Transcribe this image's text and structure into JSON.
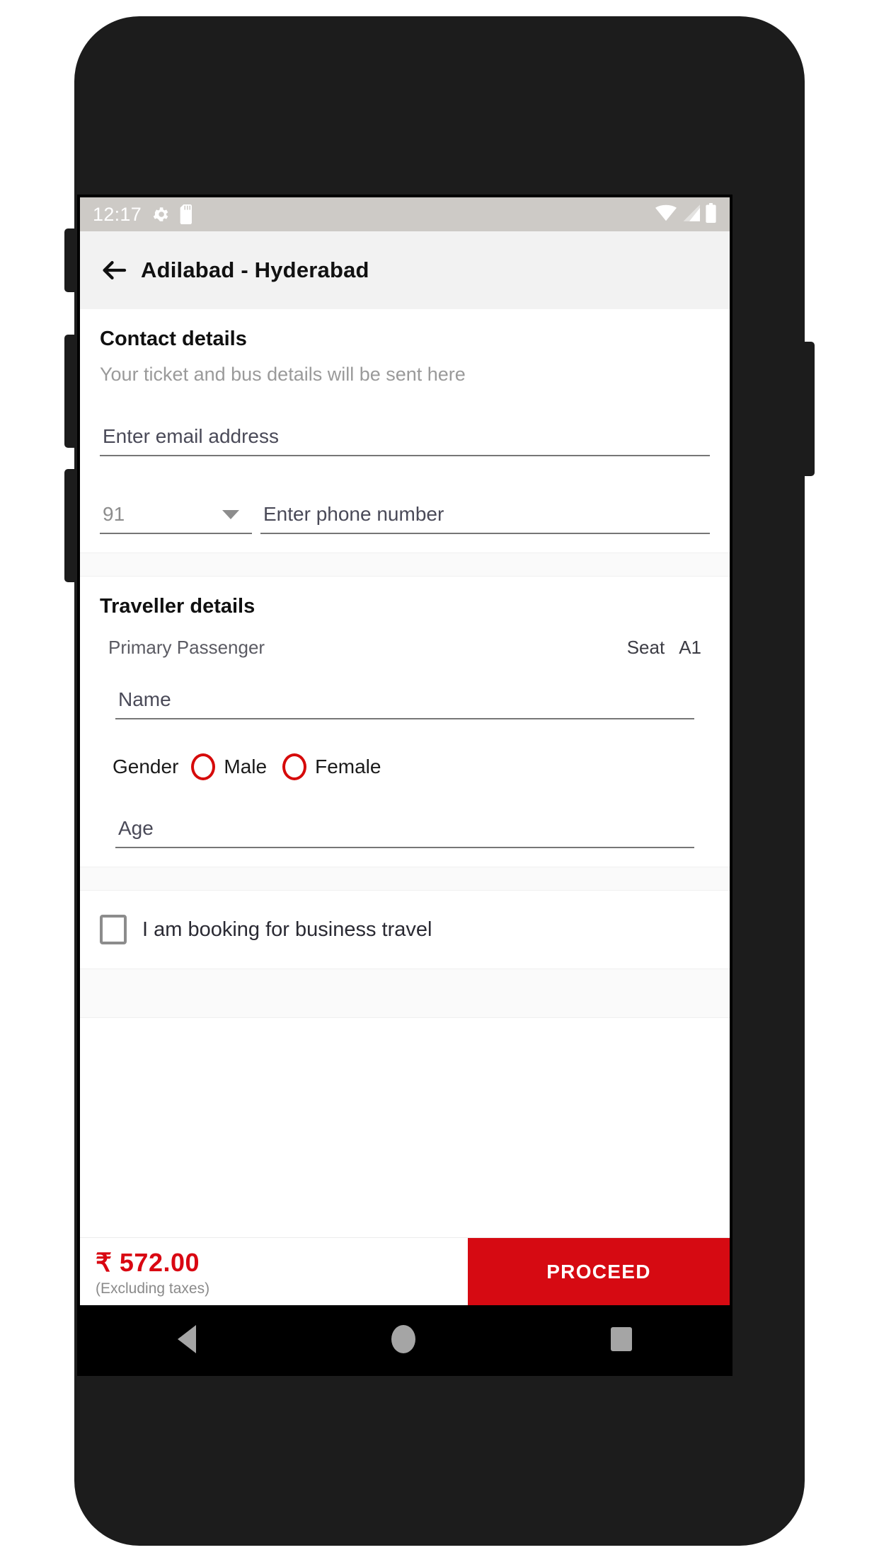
{
  "status_bar": {
    "time": "12:17",
    "left_icons": [
      "gear-icon",
      "sd-card-icon"
    ],
    "right_icons": [
      "wifi-icon",
      "cellular-signal-icon",
      "battery-icon"
    ]
  },
  "app_bar": {
    "back_icon": "back-arrow-icon",
    "title": "Adilabad - Hyderabad"
  },
  "contact": {
    "title": "Contact details",
    "subtitle": "Your ticket and bus details will be sent here",
    "email_placeholder": "Enter email address",
    "email_value": "",
    "country_code": "91",
    "phone_placeholder": "Enter phone number",
    "phone_value": ""
  },
  "traveller": {
    "title": "Traveller details",
    "passenger_label": "Primary Passenger",
    "seat_label": "Seat",
    "seat_value": "A1",
    "name_placeholder": "Name",
    "name_value": "",
    "gender_label": "Gender",
    "gender_options": [
      "Male",
      "Female"
    ],
    "age_placeholder": "Age",
    "age_value": ""
  },
  "business": {
    "checkbox_label": "I am booking for business travel",
    "checked": false
  },
  "bottom_bar": {
    "price": "₹ 572.00",
    "price_note": "(Excluding taxes)",
    "proceed_label": "PROCEED"
  },
  "nav_bar": {
    "back": "nav-back-icon",
    "home": "nav-home-icon",
    "recents": "nav-recents-icon"
  },
  "colors": {
    "accent_red": "#d60a12",
    "price_red": "#d90712",
    "status_bar": "#cdcac6",
    "app_bar": "#f2f2f2"
  }
}
